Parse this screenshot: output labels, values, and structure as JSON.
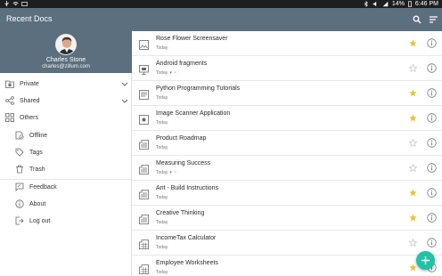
{
  "status_bar": {
    "left_icons": [
      "usb-icon",
      "wifi-icon",
      "image-icon"
    ],
    "battery": "14%",
    "time": "6:46 PM"
  },
  "app_bar": {
    "title": "Recent Docs",
    "search_icon": "search-icon",
    "sort_icon": "sort-icon"
  },
  "profile": {
    "name": "Charles Stone",
    "email": "charles@zillum.com"
  },
  "nav": {
    "private": "Private",
    "shared": "Shared",
    "others": "Others",
    "offline": "Offline",
    "tags": "Tags",
    "trash": "Trash",
    "feedback": "Feedback",
    "about": "About",
    "logout": "Log out"
  },
  "docs": [
    {
      "title": "Rose Flower Screensaver",
      "date": "Today",
      "starred": true,
      "icon": "image-file-icon",
      "offline": false
    },
    {
      "title": "Android fragments",
      "date": "Today",
      "starred": false,
      "icon": "presentation-file-icon",
      "offline": true
    },
    {
      "title": "Python Programming Tutorials",
      "date": "Today",
      "starred": true,
      "icon": "text-file-icon",
      "offline": false
    },
    {
      "title": "Image Scanner Application",
      "date": "Today",
      "starred": true,
      "icon": "scanner-file-icon",
      "offline": false
    },
    {
      "title": "Product Roadmap",
      "date": "Today",
      "starred": false,
      "icon": "document-file-icon",
      "offline": false
    },
    {
      "title": "Measuring Success",
      "date": "Today",
      "starred": false,
      "icon": "document-file-icon",
      "offline": true
    },
    {
      "title": "Ant - Build Instructions",
      "date": "Today",
      "starred": true,
      "icon": "document-file-icon",
      "offline": false
    },
    {
      "title": "Creative Thinking",
      "date": "Today",
      "starred": true,
      "icon": "document-file-icon",
      "offline": false
    },
    {
      "title": "IncomeTax Calculator",
      "date": "Today",
      "starred": false,
      "icon": "spreadsheet-file-icon",
      "offline": false
    },
    {
      "title": "Employee Worksheets",
      "date": "Today",
      "starred": true,
      "icon": "spreadsheet-file-icon",
      "offline": false
    }
  ],
  "colors": {
    "app_bar": "#5b6f7e",
    "star_on": "#e8c23a",
    "star_off": "#c4c4c4",
    "fab": "#20c3a6"
  },
  "fab_icon": "plus-icon"
}
